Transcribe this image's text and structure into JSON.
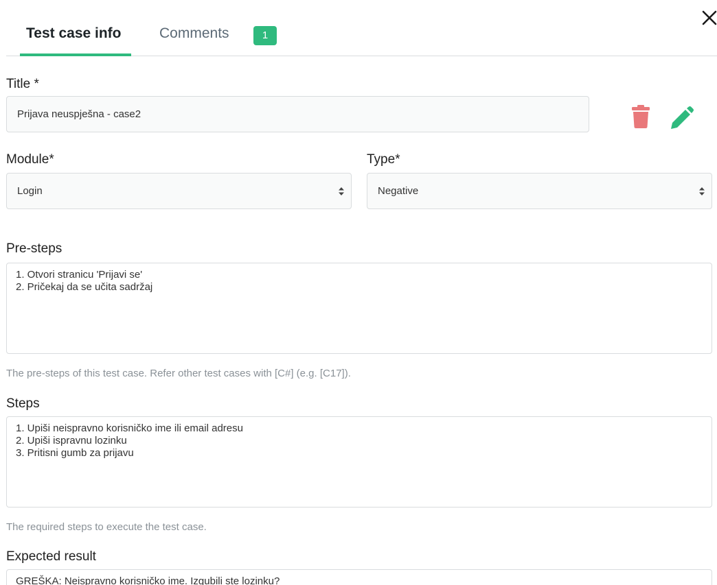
{
  "tabs": [
    {
      "label": "Test case info",
      "active": true
    },
    {
      "label": "Comments",
      "badge": "1"
    }
  ],
  "accent_color": "#2fba7e",
  "delete_color": "#e9787a",
  "title": {
    "label": "Title *",
    "value": "Prijava neuspješna - case2"
  },
  "module": {
    "label": "Module*",
    "value": "Login"
  },
  "type": {
    "label": "Type*",
    "value": "Negative"
  },
  "pre_steps": {
    "label": "Pre-steps",
    "value": "1. Otvori stranicu 'Prijavi se'\n2. Pričekaj da se učita sadržaj",
    "help": "The pre-steps of this test case. Refer other test cases with [C#] (e.g. [C17])."
  },
  "steps": {
    "label": "Steps",
    "value": "1. Upiši neispravno korisničko ime ili email adresu\n2. Upiši ispravnu lozinku\n3. Pritisni gumb za prijavu",
    "help": "The required steps to execute the test case."
  },
  "expected_result": {
    "label": "Expected result",
    "value": "GREŠKA: Neispravno korisničko ime. Izgubili ste lozinku?"
  },
  "icons": {
    "close": "close-icon",
    "delete": "trash-icon",
    "edit": "pencil-icon",
    "select": "sort-arrows-icon"
  }
}
